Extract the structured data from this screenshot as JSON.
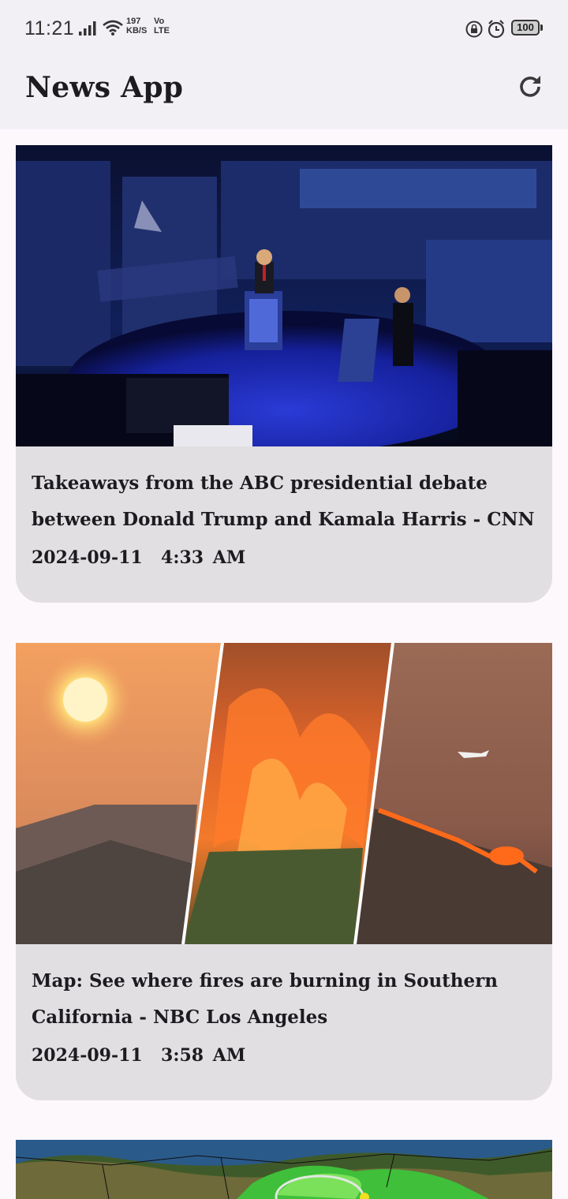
{
  "status_bar": {
    "time": "11:21",
    "net_speed_value": "197",
    "net_speed_unit": "KB/S",
    "volte_top": "Vo",
    "volte_bottom": "LTE",
    "battery": "100"
  },
  "app_bar": {
    "title": "News App",
    "refresh_icon": "refresh-icon"
  },
  "articles": [
    {
      "title": "Takeaways from the ABC presidential debate between Donald Trump and Kamala Harris - CNN",
      "date": "2024-09-11  4:33 AM"
    },
    {
      "title": "Map: See where fires are burning in Southern California - NBC Los Angeles",
      "date": "2024-09-11  3:58 AM"
    }
  ]
}
